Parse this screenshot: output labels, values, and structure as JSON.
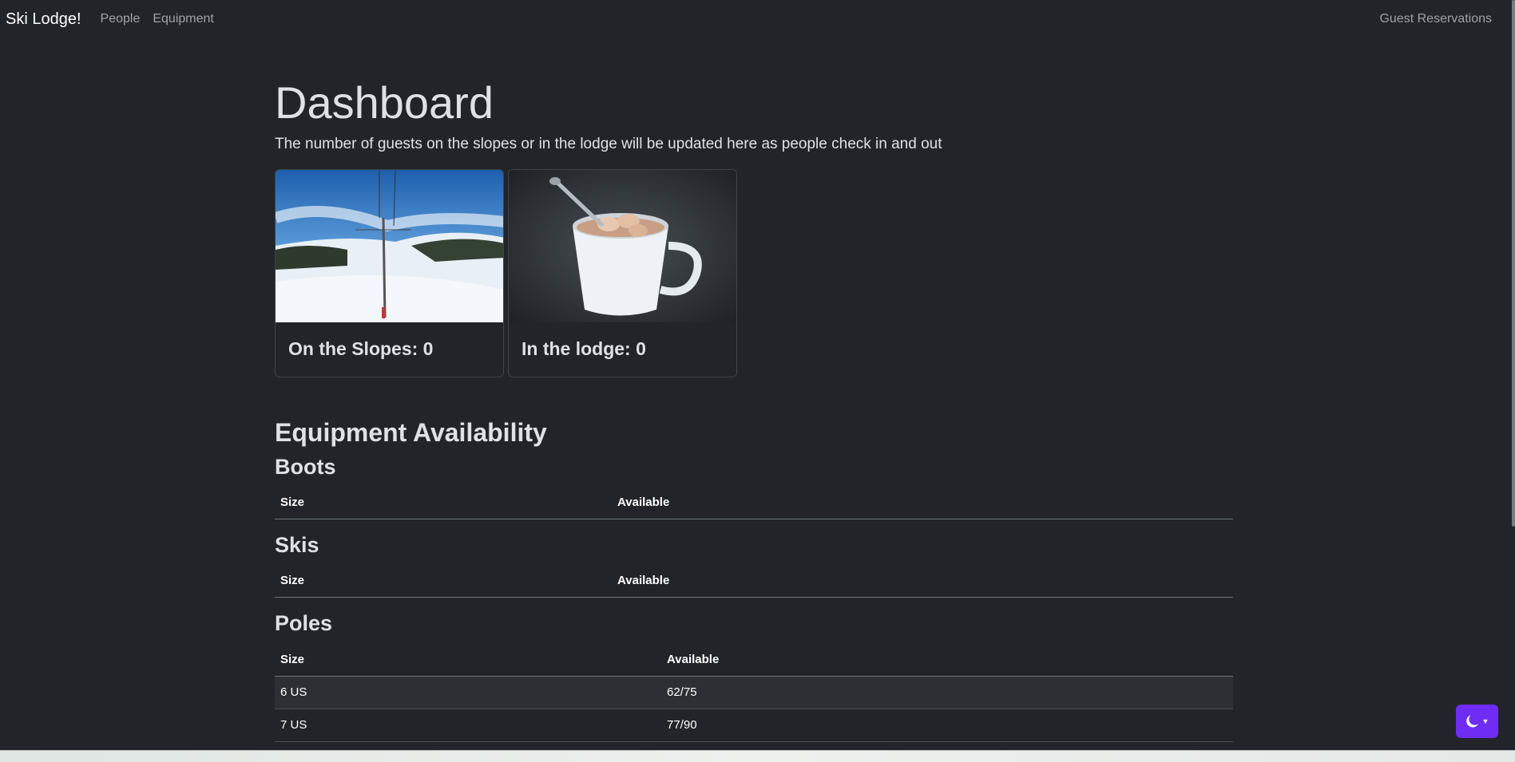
{
  "nav": {
    "brand": "Ski Lodge!",
    "links": [
      "People",
      "Equipment"
    ],
    "right_link": "Guest Reservations"
  },
  "page": {
    "title": "Dashboard",
    "lead": "The number of guests on the slopes or in the lodge will be updated here as people check in and out"
  },
  "cards": [
    {
      "title": "On the Slopes: 0",
      "image": "ski-slope-photo"
    },
    {
      "title": "In the lodge: 0",
      "image": "hot-cocoa-photo"
    }
  ],
  "equipment": {
    "title": "Equipment Availability",
    "boots": {
      "title": "Boots",
      "headers": [
        "Size",
        "Available"
      ]
    },
    "skis": {
      "title": "Skis",
      "headers": [
        "Size",
        "Available"
      ]
    },
    "poles": {
      "title": "Poles",
      "headers": [
        "Size",
        "Available"
      ],
      "rows": [
        [
          "6 US",
          "62/75"
        ],
        [
          "7 US",
          "77/90"
        ]
      ]
    }
  },
  "theme_toggle": {
    "icon": "moon-icon",
    "color": "#6f2cf5"
  }
}
